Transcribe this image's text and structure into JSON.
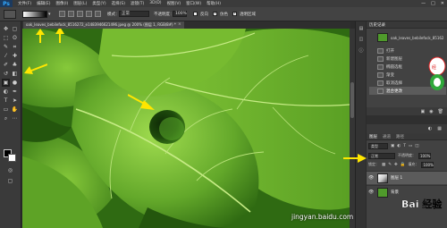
{
  "app": {
    "logo": "Ps"
  },
  "menu": [
    "文件(F)",
    "编辑(E)",
    "图像(I)",
    "图层(L)",
    "类型(Y)",
    "选择(S)",
    "滤镜(T)",
    "3D(D)",
    "视图(V)",
    "窗口(W)",
    "帮助(H)"
  ],
  "window_controls": {
    "minimize": "—",
    "maximize": "□",
    "close": "✕"
  },
  "options_bar": {
    "mode_label": "模式：",
    "mode_value": "正常",
    "opacity_label": "不透明度：",
    "opacity_value": "100%",
    "reverse_label": "反向",
    "dither_label": "仿色",
    "transparency_label": "透明区域",
    "reverse_checked": false,
    "dither_checked": true,
    "transparency_checked": true
  },
  "document": {
    "tab_title": "oak_leaves_bebilefock_8516272_e1483946621496.jpeg @ 200% (图层 1, RGB/8#) *",
    "close_glyph": "×"
  },
  "colors": {
    "foreground": "#000000",
    "background": "#ffffff",
    "arrow": "#ffe600",
    "leaf_light": "#8bd13a",
    "leaf_dark": "#2f6a12"
  },
  "history_panel": {
    "tab_label": "历史记录",
    "snapshot_label": "oak_leaves_bebilefock_85162...",
    "items": [
      {
        "label": "打开",
        "selected": false
      },
      {
        "label": "新建图层",
        "selected": false
      },
      {
        "label": "椭圆选框",
        "selected": false
      },
      {
        "label": "渐变",
        "selected": false
      },
      {
        "label": "取消选择",
        "selected": false
      },
      {
        "label": "混合更改",
        "selected": true
      }
    ]
  },
  "layers_panel": {
    "tabs": [
      {
        "label": "图层",
        "active": true
      },
      {
        "label": "通道",
        "active": false
      },
      {
        "label": "路径",
        "active": false
      }
    ],
    "filter_kind": "类型",
    "blend_mode": "正常",
    "opacity_label": "不透明度：",
    "opacity_value": "100%",
    "lock_label": "锁定：",
    "fill_label": "填充：",
    "fill_value": "100%",
    "layers": [
      {
        "name": "图层 1",
        "selected": true,
        "visible": true
      },
      {
        "name": "背景",
        "selected": false,
        "visible": true
      }
    ]
  },
  "watermark": "jingyan.baidu.com",
  "baidu_logo_text": "Bai 经验"
}
